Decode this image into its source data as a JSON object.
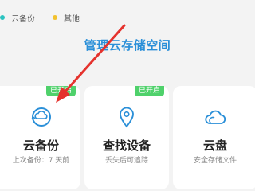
{
  "legend": [
    {
      "label": "云备份",
      "color": "#2bc3c0"
    },
    {
      "label": "其他",
      "color": "#f2c12e"
    }
  ],
  "manage_link": "管理云存储空间",
  "cards": {
    "backup": {
      "title": "云备份",
      "subtitle": "上次备份：7 天前",
      "badge": "已开启",
      "icon": "cloud-backup-icon"
    },
    "find": {
      "title": "查找设备",
      "subtitle": "丢失后可追踪",
      "badge": "已开启",
      "icon": "location-pin-icon"
    },
    "drive": {
      "title": "云盘",
      "subtitle": "安全存储文件",
      "icon": "cloud-icon"
    }
  },
  "colors": {
    "accent": "#2a8fd8",
    "badge": "#4fd16b",
    "annotation_arrow": "#e5322d"
  }
}
